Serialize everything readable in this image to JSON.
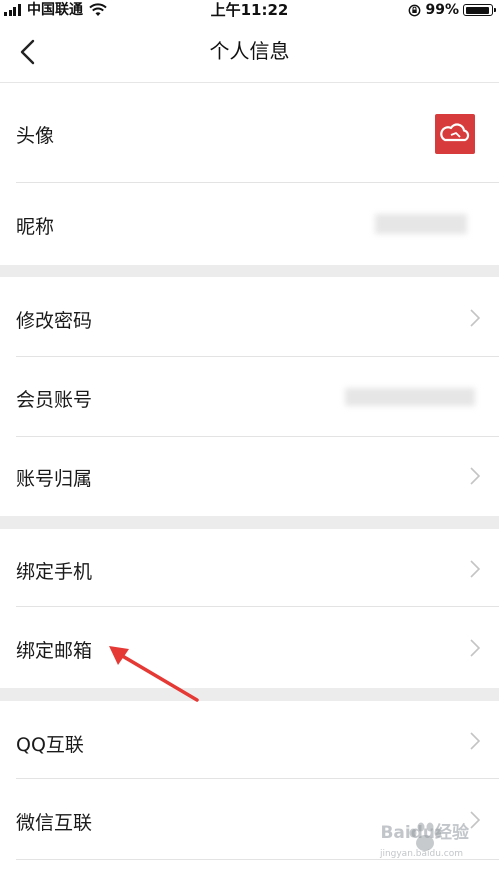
{
  "status_bar": {
    "carrier": "中国联通",
    "time": "上午11:22",
    "battery": "99%",
    "battery_level": 0.99
  },
  "nav": {
    "title": "个人信息",
    "back_icon": "chevron-left-icon"
  },
  "rows": {
    "avatar": "头像",
    "nickname": "昵称",
    "change_password": "修改密码",
    "member_account": "会员账号",
    "account_belong": "账号归属",
    "bind_phone": "绑定手机",
    "bind_email": "绑定邮箱",
    "qq_connect": "QQ互联",
    "wechat_connect": "微信互联"
  },
  "colors": {
    "avatar_bg": "#d83b3b",
    "arrow": "#e53935",
    "separator": "#ececec"
  },
  "watermark": {
    "brand": "Baidu经验",
    "url": "jingyan.baidu.com"
  }
}
